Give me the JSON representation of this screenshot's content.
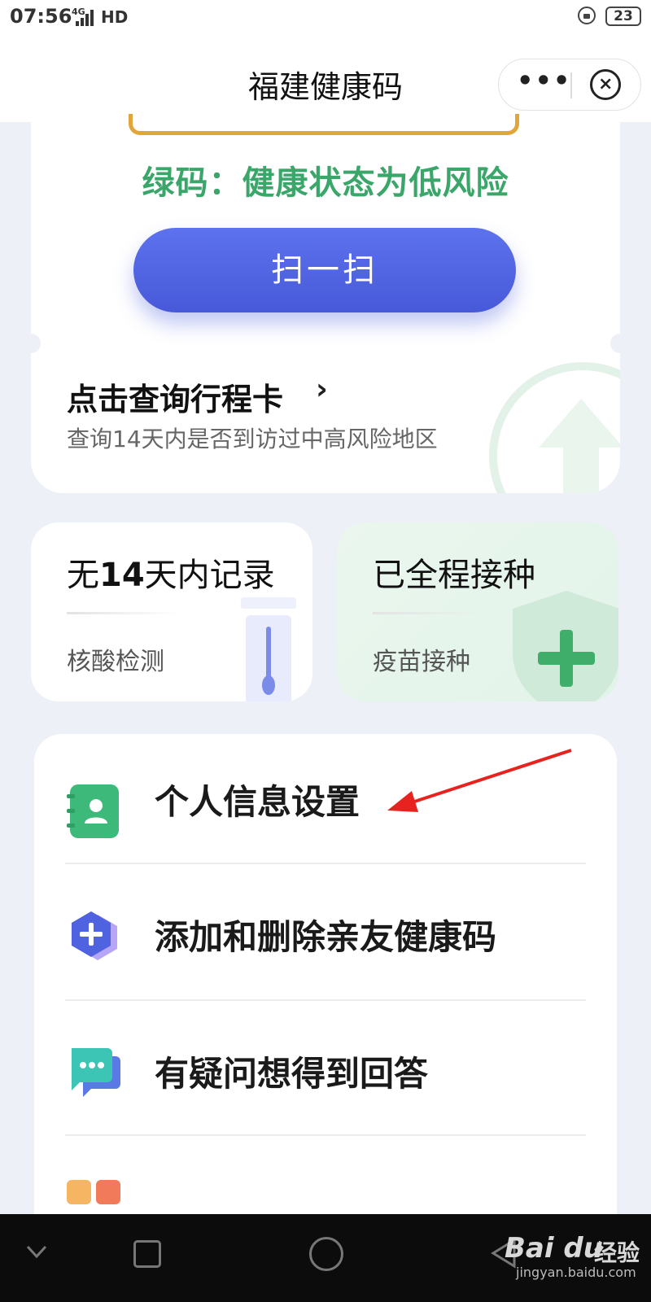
{
  "status_bar": {
    "time": "07:56",
    "network": "4G",
    "hd": "HD",
    "battery": "23"
  },
  "nav": {
    "title": "福建健康码",
    "more_glyph": "•••",
    "close_glyph": "×"
  },
  "health": {
    "status_text": "绿码：健康状态为低风险",
    "status_color": "#3ba66a",
    "scan_label": "扫一扫"
  },
  "trip": {
    "title": "点击查询行程卡",
    "chevron": "›",
    "subtitle": "查询14天内是否到访过中高风险地区"
  },
  "nucleic": {
    "title_prefix": "无",
    "title_number": "14",
    "title_suffix": "天内记录",
    "label": "核酸检测"
  },
  "vaccine": {
    "title": "已全程接种",
    "label": "疫苗接种"
  },
  "menu": {
    "items": [
      {
        "label": "个人信息设置",
        "icon": "contact-book-icon"
      },
      {
        "label": "添加和删除亲友健康码",
        "icon": "add-hexagon-icon"
      },
      {
        "label": "有疑问想得到回答",
        "icon": "chat-bubble-icon"
      },
      {
        "label": "",
        "icon": "grid-icon"
      }
    ]
  },
  "watermark": {
    "logo": "Bai du",
    "jingyan": "经验",
    "url": "jingyan.baidu.com"
  },
  "colors": {
    "accent_blue": "#4f63e0",
    "green": "#3ba66a",
    "gold_frame": "#e0a63a",
    "annotation_red": "#e8231f"
  }
}
